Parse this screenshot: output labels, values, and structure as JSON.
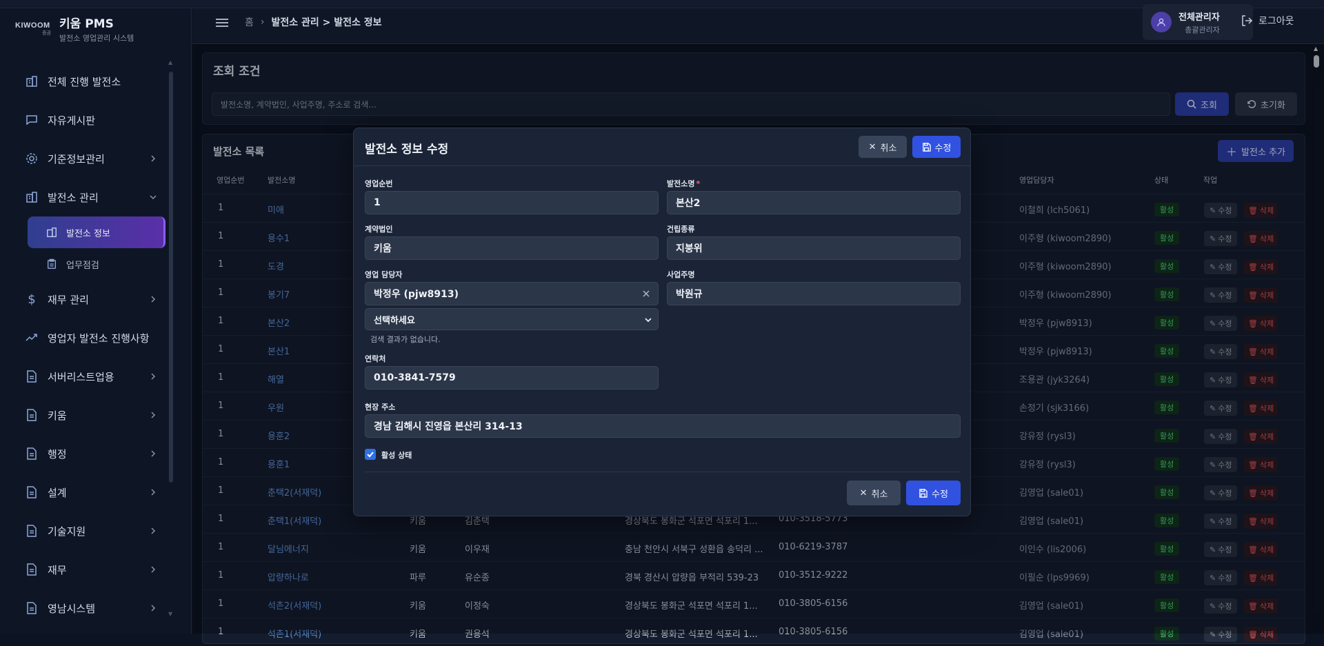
{
  "app": {
    "logo_mark": "KIWOOM",
    "logo_mark_sub": "증권",
    "title": "키움 PMS",
    "subtitle": "발전소 영업관리 시스템"
  },
  "sidebar": {
    "items": [
      {
        "label": "전체 진행 발전소",
        "icon": "building-icon"
      },
      {
        "label": "자유게시판",
        "icon": "chat-icon"
      },
      {
        "label": "기준정보관리",
        "icon": "gear-icon"
      },
      {
        "label": "발전소 관리",
        "icon": "building-icon"
      },
      {
        "label": "재무 관리",
        "icon": "dollar-icon"
      },
      {
        "label": "영업자 발전소 진행사항",
        "icon": "trend-icon"
      },
      {
        "label": "서버리스트업용",
        "icon": "document-icon"
      },
      {
        "label": "키움",
        "icon": "document-icon"
      },
      {
        "label": "행정",
        "icon": "document-icon"
      },
      {
        "label": "설계",
        "icon": "document-icon"
      },
      {
        "label": "기술지원",
        "icon": "document-icon"
      },
      {
        "label": "재무",
        "icon": "document-icon"
      },
      {
        "label": "영남시스템",
        "icon": "document-icon"
      }
    ],
    "sub_items": [
      {
        "label": "발전소 정보",
        "active": true
      },
      {
        "label": "업무점검",
        "active": false
      }
    ]
  },
  "header": {
    "breadcrumb_home": "홈",
    "breadcrumb_current": "발전소 관리 > 발전소 정보",
    "user_name": "전체관리자",
    "user_role": "총괄관리자",
    "logout_label": "로그아웃"
  },
  "search": {
    "title": "조회 조건",
    "placeholder": "발전소명, 계약법인, 사업주명, 주소로 검색...",
    "search_label": "조회",
    "reset_label": "초기화"
  },
  "list": {
    "title": "발전소 목록",
    "add_label": "발전소 추가",
    "columns": {
      "seq": "영업순번",
      "name": "발전소명",
      "manager": "영업담당자",
      "status": "상태",
      "action": "작업"
    },
    "edit_label": "수정",
    "delete_label": "삭제",
    "rows": [
      {
        "seq": "1",
        "name": "미애",
        "corp": "",
        "owner": "",
        "addr": "",
        "phone": "",
        "manager": "이철희 (lch5061)",
        "status": "활성"
      },
      {
        "seq": "1",
        "name": "용수1",
        "corp": "",
        "owner": "",
        "addr": "",
        "phone": "",
        "manager": "이주형 (kiwoom2890)",
        "status": "활성"
      },
      {
        "seq": "1",
        "name": "도경",
        "corp": "",
        "owner": "",
        "addr": "",
        "phone": "",
        "manager": "이주형 (kiwoom2890)",
        "status": "활성"
      },
      {
        "seq": "1",
        "name": "봉기7",
        "corp": "",
        "owner": "",
        "addr": "",
        "phone": "",
        "manager": "이주형 (kiwoom2890)",
        "status": "활성"
      },
      {
        "seq": "1",
        "name": "본산2",
        "corp": "",
        "owner": "",
        "addr": "",
        "phone": "",
        "manager": "박정우 (pjw8913)",
        "status": "활성"
      },
      {
        "seq": "1",
        "name": "본산1",
        "corp": "",
        "owner": "",
        "addr": "",
        "phone": "",
        "manager": "박정우 (pjw8913)",
        "status": "활성"
      },
      {
        "seq": "1",
        "name": "해열",
        "corp": "",
        "owner": "",
        "addr": "",
        "phone": "",
        "manager": "조용관 (jyk3264)",
        "status": "활성"
      },
      {
        "seq": "1",
        "name": "우원",
        "corp": "",
        "owner": "",
        "addr": "",
        "phone": "",
        "manager": "손정기 (sjk3166)",
        "status": "활성"
      },
      {
        "seq": "1",
        "name": "용훈2",
        "corp": "",
        "owner": "",
        "addr": "",
        "phone": "",
        "manager": "강유정 (rysl3)",
        "status": "활성"
      },
      {
        "seq": "1",
        "name": "용훈1",
        "corp": "",
        "owner": "",
        "addr": "",
        "phone": "",
        "manager": "강유정 (rysl3)",
        "status": "활성"
      },
      {
        "seq": "1",
        "name": "춘택2(서재덕)",
        "corp": "",
        "owner": "",
        "addr": "",
        "phone": "",
        "manager": "김영업 (sale01)",
        "status": "활성"
      },
      {
        "seq": "1",
        "name": "춘택1(서재덕)",
        "corp": "키움",
        "owner": "김춘택",
        "addr": "경상북도 봉화군 석포면 석포리 1...",
        "phone": "010-3518-5773",
        "manager": "김영업 (sale01)",
        "status": "활성"
      },
      {
        "seq": "1",
        "name": "달님에너지",
        "corp": "키움",
        "owner": "이우재",
        "addr": "충남 천안시 서북구 성환읍 송덕리 ...",
        "phone": "010-6219-3787",
        "manager": "이인수 (lis2006)",
        "status": "활성"
      },
      {
        "seq": "1",
        "name": "압량하나로",
        "corp": "파루",
        "owner": "유순종",
        "addr": "경북 경산시 압량읍 부적리 539-23",
        "phone": "010-3512-9222",
        "manager": "이필순 (lps9969)",
        "status": "활성"
      },
      {
        "seq": "1",
        "name": "석촌2(서재덕)",
        "corp": "키움",
        "owner": "이정숙",
        "addr": "경상북도 봉화군 석포면 석포리 1...",
        "phone": "010-3805-6156",
        "manager": "김영업 (sale01)",
        "status": "활성"
      },
      {
        "seq": "1",
        "name": "석촌1(서재덕)",
        "corp": "키움",
        "owner": "권용석",
        "addr": "경상북도 봉화군 석포면 석포리 1...",
        "phone": "010-3805-6156",
        "manager": "김영업 (sale01)",
        "status": "활성"
      }
    ]
  },
  "modal": {
    "title": "발전소 정보 수정",
    "cancel_label": "취소",
    "save_label": "수정",
    "seq_label": "영업순번",
    "seq_value": "1",
    "name_label": "발전소명",
    "name_required": "*",
    "name_value": "본산2",
    "corp_label": "계약법인",
    "corp_value": "키움",
    "build_label": "건립종류",
    "build_value": "지붕위",
    "manager_label": "영업 담당자",
    "manager_value": "박정우 (pjw8913)",
    "manager_select": "선택하세요",
    "manager_hint": "검색 결과가 없습니다.",
    "owner_label": "사업주명",
    "owner_value": "박원규",
    "phone_label": "연락처",
    "phone_value": "010-3841-7579",
    "addr_label": "현장 주소",
    "addr_value": "경남 김해시 진영읍 본산리 314-13",
    "active_label": "활성 상태",
    "active_checked": true
  },
  "colors": {
    "accent": "#3152e0",
    "active_badge": "#4ad07a",
    "delete": "#e0555f",
    "link": "#5f8fd8"
  }
}
